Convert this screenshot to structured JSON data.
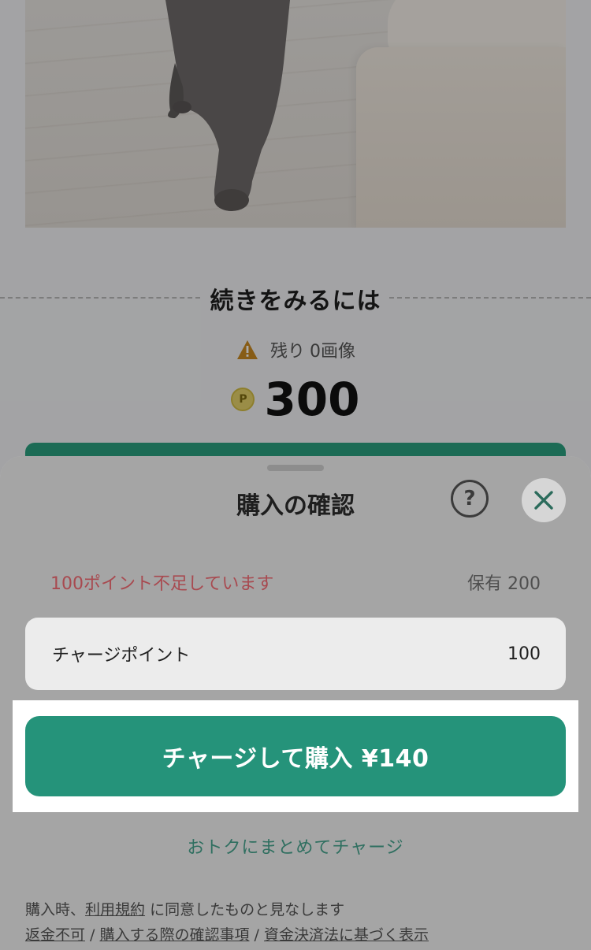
{
  "background": {
    "section_title": "続きをみるには",
    "remaining_label": "残り",
    "remaining_value": "0画像",
    "coin_symbol": "P",
    "price": "300",
    "accent_color": "#2aa07f"
  },
  "sheet": {
    "title": "購入の確認",
    "help_symbol": "?",
    "shortage_text": "100ポイント不足しています",
    "owned_label": "保有",
    "owned_value": "200",
    "charge_label": "チャージポイント",
    "charge_value": "100",
    "cta_label": "チャージして購入 ¥140",
    "bulk_link": "おトクにまとめてチャージ",
    "legal": {
      "prefix": "購入時、",
      "terms_link": "利用規約",
      "suffix": " に同意したものと見なします",
      "refund_link": "返金不可",
      "confirm_link": "購入する際の確認事項",
      "law_link": "資金決済法に基づく表示",
      "separator": " / "
    },
    "cta_color": "#25937a",
    "warning_color": "#a84a50"
  }
}
